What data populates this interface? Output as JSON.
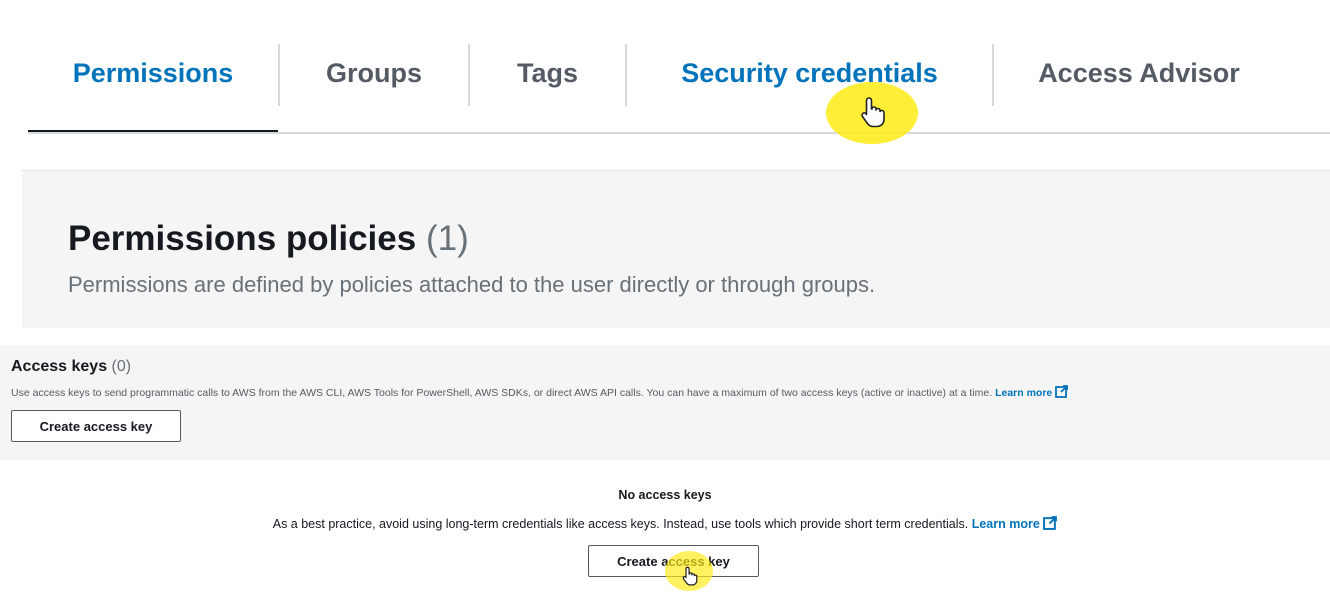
{
  "tabs": [
    {
      "label": "Permissions",
      "state": "active"
    },
    {
      "label": "Groups",
      "state": "inactive"
    },
    {
      "label": "Tags",
      "state": "inactive"
    },
    {
      "label": "Security credentials",
      "state": "hover"
    },
    {
      "label": "Access Advisor",
      "state": "inactive"
    }
  ],
  "policies": {
    "title": "Permissions policies",
    "count": "(1)",
    "description": "Permissions are defined by policies attached to the user directly or through groups."
  },
  "access_keys": {
    "title": "Access keys",
    "count": "(0)",
    "description": "Use access keys to send programmatic calls to AWS from the AWS CLI, AWS Tools for PowerShell, AWS SDKs, or direct AWS API calls. You can have a maximum of two access keys (active or inactive) at a time.",
    "learn_more": "Learn more",
    "create_button": "Create access key"
  },
  "empty_state": {
    "title": "No access keys",
    "description": "As a best practice, avoid using long-term credentials like access keys. Instead, use tools which provide short term credentials.",
    "learn_more": "Learn more",
    "create_button": "Create access key"
  },
  "icons": {
    "external_link": "external-link-icon",
    "cursor": "hand-pointer-icon"
  },
  "colors": {
    "link": "#0073bb",
    "cursor_highlight": "#ffeb14",
    "panel_bg": "#f5f5f5"
  }
}
